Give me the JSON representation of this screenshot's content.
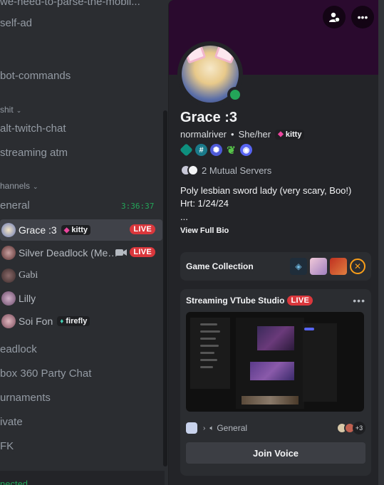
{
  "sidebar": {
    "channels": [
      {
        "label": "we-need-to-parse-the-mobil..."
      },
      {
        "label": "self-ad"
      },
      {
        "label": "bot-commands"
      }
    ],
    "category_shit": "shit",
    "channels2": [
      {
        "label": "alt-twitch-chat"
      },
      {
        "label": "streaming atm"
      }
    ],
    "category_channels": "hannels",
    "voice_channel": {
      "label": "eneral",
      "timer": "3:36:37"
    },
    "voice_users": [
      {
        "name": "Grace :3",
        "tag": "kitty",
        "live": "LIVE"
      },
      {
        "name": "Silver Deadlock (Mei...",
        "live": "LIVE"
      },
      {
        "name": "Gabi"
      },
      {
        "name": "Lilly"
      },
      {
        "name": "Soi Fon",
        "tag": "firefly"
      }
    ],
    "more_channels": [
      {
        "label": "eadlock"
      },
      {
        "label": "box 360 Party Chat"
      },
      {
        "label": "urnaments"
      },
      {
        "label": "ivate"
      },
      {
        "label": "FK"
      }
    ],
    "bottom_text": "nected"
  },
  "profile": {
    "display_name": "Grace :3",
    "username": "normalriver",
    "pronouns": "She/her",
    "tag": "kitty",
    "mutual_servers": "2 Mutual Servers",
    "bio_line1": "Poly lesbian sword lady (very scary, Boo!)",
    "bio_line2": "Hrt: 1/24/24",
    "bio_ellipsis": "...",
    "view_full_bio": "View Full Bio",
    "game_collection": "Game Collection",
    "stream": {
      "title": "Streaming VTube Studio",
      "live": "LIVE",
      "channel": "General",
      "extra_count": "+3",
      "join_label": "Join Voice"
    }
  },
  "colors": {
    "online": "#23a559",
    "live": "#da373c",
    "banner": "#2a0a2e"
  }
}
